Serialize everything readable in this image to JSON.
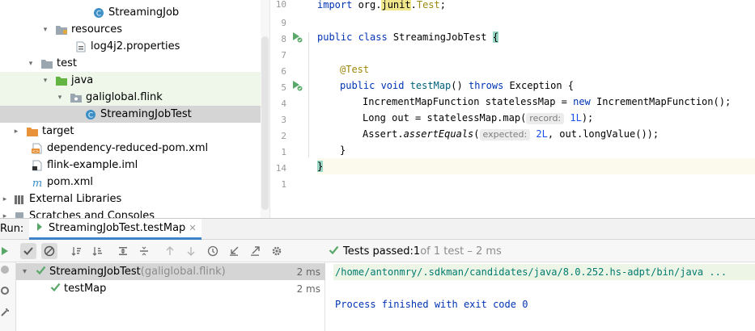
{
  "project_tree": {
    "items": [
      {
        "label": "StreamingJob",
        "icon": "java-class-icon",
        "depth": 5,
        "arrow": ""
      },
      {
        "label": "resources",
        "icon": "resources-folder-icon",
        "depth": 3,
        "arrow": "down"
      },
      {
        "label": "log4j2.properties",
        "icon": "properties-file-icon",
        "depth": 4,
        "arrow": ""
      },
      {
        "label": "test",
        "icon": "folder-icon",
        "depth": 2,
        "arrow": "down"
      },
      {
        "label": "java",
        "icon": "test-source-folder-icon",
        "depth": 3,
        "arrow": "down"
      },
      {
        "label": "galiglobal.flink",
        "icon": "package-icon",
        "depth": 4,
        "arrow": "down"
      },
      {
        "label": "StreamingJobTest",
        "icon": "java-class-icon",
        "depth": 5,
        "arrow": ""
      },
      {
        "label": "target",
        "icon": "excluded-folder-icon",
        "depth": 1,
        "arrow": "right"
      },
      {
        "label": "dependency-reduced-pom.xml",
        "icon": "xml-file-icon",
        "depth": 1,
        "arrow": ""
      },
      {
        "label": "flink-example.iml",
        "icon": "iml-file-icon",
        "depth": 1,
        "arrow": ""
      },
      {
        "label": "pom.xml",
        "icon": "maven-file-icon",
        "depth": 1,
        "arrow": ""
      },
      {
        "label": "External Libraries",
        "icon": "libraries-icon",
        "depth": 0,
        "arrow": "right"
      },
      {
        "label": "Scratches and Consoles",
        "icon": "scratches-icon",
        "depth": 0,
        "arrow": "right"
      }
    ]
  },
  "editor": {
    "line_numbers": [
      "10",
      "9",
      "8",
      "7",
      "6",
      "5",
      "4",
      "3",
      "2",
      "1",
      "14",
      "1"
    ],
    "code": {
      "l10_import": "import ",
      "l10_pkg1": "org.",
      "l10_junit": "junit",
      "l10_pkg2": ".",
      "l10_test": "Test",
      "l10_semi": ";",
      "l8_kw": "public class ",
      "l8_name": "StreamingJobTest ",
      "l8_brace": "{",
      "l6_ann": "@Test",
      "l5_kw1": "public void ",
      "l5_name": "testMap",
      "l5_mid": "() ",
      "l5_kw2": "throws",
      "l5_end": " Exception {",
      "l4_a": "IncrementMapFunction statelessMap = ",
      "l4_kw": "new",
      "l4_b": " IncrementMapFunction();",
      "l3_a": "Long out = statelessMap.map(",
      "l3_hint": "record:",
      "l3_num": "1L",
      "l3_b": ");",
      "l2_a": "Assert.",
      "l2_method": "assertEquals",
      "l2_b": "(",
      "l2_hint": "expected:",
      "l2_num": "2L",
      "l2_c": ", out.longValue());",
      "l1_brace": "}",
      "l14_brace": "}"
    }
  },
  "run_panel": {
    "label": "Run:",
    "tab_title": "StreamingJobTest.testMap",
    "status_passed": "Tests passed: ",
    "status_count": "1",
    "status_rest": " of 1 test – 2 ms",
    "results": [
      {
        "name": "StreamingJobTest",
        "pkg": " (galiglobal.flink)",
        "duration": "2 ms"
      },
      {
        "name": "testMap",
        "pkg": "",
        "duration": "2 ms"
      }
    ],
    "console": {
      "command": "/home/antonmry/.sdkman/candidates/java/8.0.252.hs-adpt/bin/java ...",
      "finished": "Process finished with exit code 0"
    }
  },
  "colors": {
    "accent": "#4083c9",
    "pass_green": "#59a869",
    "selection": "#d5d5d5",
    "test_highlight": "#eef7e9"
  }
}
